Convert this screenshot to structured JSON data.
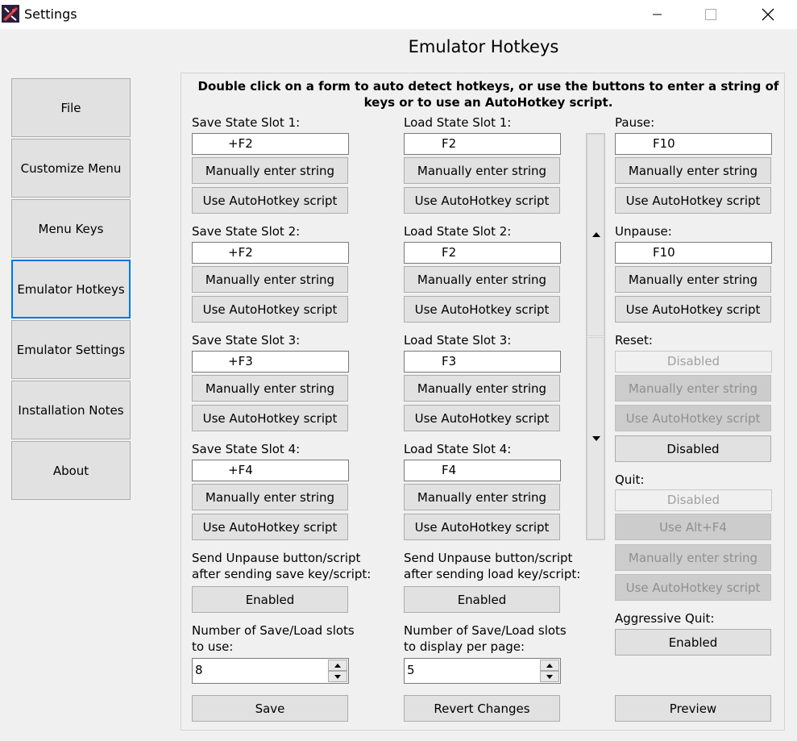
{
  "window": {
    "title": "Settings"
  },
  "page_heading": "Emulator Hotkeys",
  "sidebar": {
    "items": [
      {
        "label": "File"
      },
      {
        "label": "Customize Menu"
      },
      {
        "label": "Menu Keys"
      },
      {
        "label": "Emulator Hotkeys",
        "active": true
      },
      {
        "label": "Emulator Settings"
      },
      {
        "label": "Installation Notes"
      },
      {
        "label": "About"
      }
    ]
  },
  "instructions": "Double click on a form to auto detect hotkeys, or use the buttons to enter a string of keys or to use an AutoHotkey script.",
  "buttons": {
    "manual": "Manually enter string",
    "ahk": "Use AutoHotkey script"
  },
  "save_slots": [
    {
      "label": "Save State Slot 1:",
      "value": "+F2"
    },
    {
      "label": "Save State Slot 2:",
      "value": "+F2"
    },
    {
      "label": "Save State Slot 3:",
      "value": "+F3"
    },
    {
      "label": "Save State Slot 4:",
      "value": "+F4"
    }
  ],
  "load_slots": [
    {
      "label": "Load State Slot 1:",
      "value": "F2"
    },
    {
      "label": "Load State Slot 2:",
      "value": "F2"
    },
    {
      "label": "Load State Slot 3:",
      "value": "F3"
    },
    {
      "label": "Load State Slot 4:",
      "value": "F4"
    }
  ],
  "pause": {
    "label": "Pause:",
    "value": "F10"
  },
  "unpause": {
    "label": "Unpause:",
    "value": "F10"
  },
  "reset": {
    "label": "Reset:",
    "value": "Disabled",
    "toggle": "Disabled"
  },
  "quit": {
    "label": "Quit:",
    "value": "Disabled",
    "alt_f4": "Use Alt+F4"
  },
  "aggressive_quit": {
    "label": "Aggressive Quit:",
    "toggle": "Enabled"
  },
  "send_unpause_save": {
    "label": "Send Unpause button/script\nafter sending save key/script:",
    "toggle": "Enabled"
  },
  "send_unpause_load": {
    "label": "Send Unpause button/script\nafter sending load key/script:",
    "toggle": "Enabled"
  },
  "slots_to_use": {
    "label": "Number of Save/Load slots\nto use:",
    "value": "8"
  },
  "slots_per_page": {
    "label": "Number of Save/Load slots\nto display per page:",
    "value": "5"
  },
  "footer": {
    "save": "Save",
    "revert": "Revert Changes",
    "preview": "Preview"
  },
  "colors": {
    "accent": "#0078d7",
    "button_bg": "#e1e1e1",
    "panel_bg": "#f0f0f0"
  }
}
